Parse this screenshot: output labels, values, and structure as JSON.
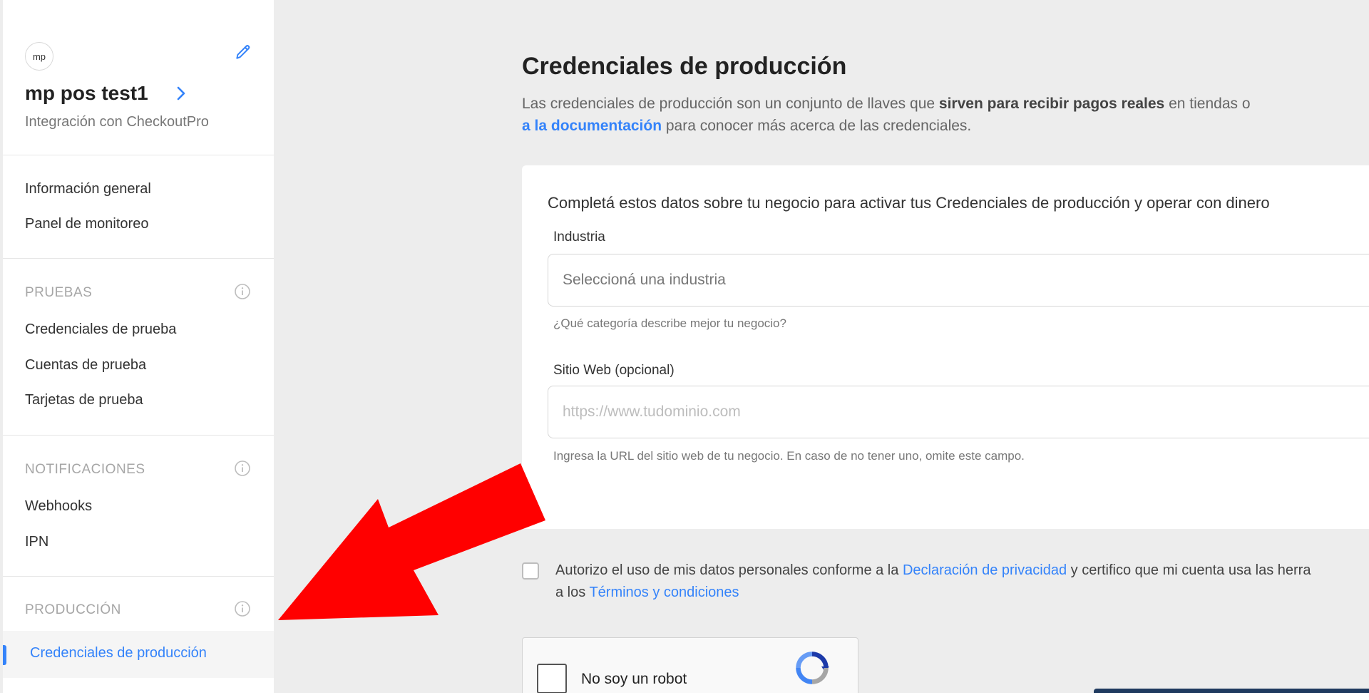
{
  "sidebar": {
    "avatar_text": "mp",
    "app_name": "mp pos test1",
    "app_subtitle": "Integración con CheckoutPro",
    "general_items": [
      "Información general",
      "Panel de monitoreo"
    ],
    "sections": [
      {
        "title": "PRUEBAS",
        "items": [
          "Credenciales de prueba",
          "Cuentas de prueba",
          "Tarjetas de prueba"
        ]
      },
      {
        "title": "NOTIFICACIONES",
        "items": [
          "Webhooks",
          "IPN"
        ]
      },
      {
        "title": "PRODUCCIÓN",
        "items": [
          "Credenciales de producción"
        ]
      }
    ],
    "active_item": "Credenciales de producción"
  },
  "main": {
    "title": "Credenciales de producción",
    "desc_part1": "Las credenciales de producción son un conjunto de llaves que ",
    "desc_bold": "sirven para recibir pagos reales",
    "desc_part2": " en tiendas o",
    "desc_link": "a la documentación",
    "desc_part3": " para conocer más acerca de las credenciales.",
    "form": {
      "intro": "Completá estos datos sobre tu negocio para activar tus Credenciales de producción y operar con dinero",
      "industry_label": "Industria",
      "industry_placeholder": "Seleccioná una industria",
      "industry_help": "¿Qué categoría describe mejor tu negocio?",
      "website_label": "Sitio Web (opcional)",
      "website_placeholder": "https://www.tudominio.com",
      "website_help": "Ingresa la URL del sitio web de tu negocio. En caso de no tener uno, omite este campo."
    },
    "consent": {
      "part1": "Autorizo el uso de mis datos personales conforme a la ",
      "privacy_link": "Declaración de privacidad",
      "part2": " y certifico que mi cuenta usa las herra",
      "part3": "a los ",
      "terms_link": "Términos y condiciones"
    },
    "recaptcha_label": "No soy un robot"
  },
  "colors": {
    "accent": "#3483fa",
    "annotation_arrow": "#ff0000"
  }
}
